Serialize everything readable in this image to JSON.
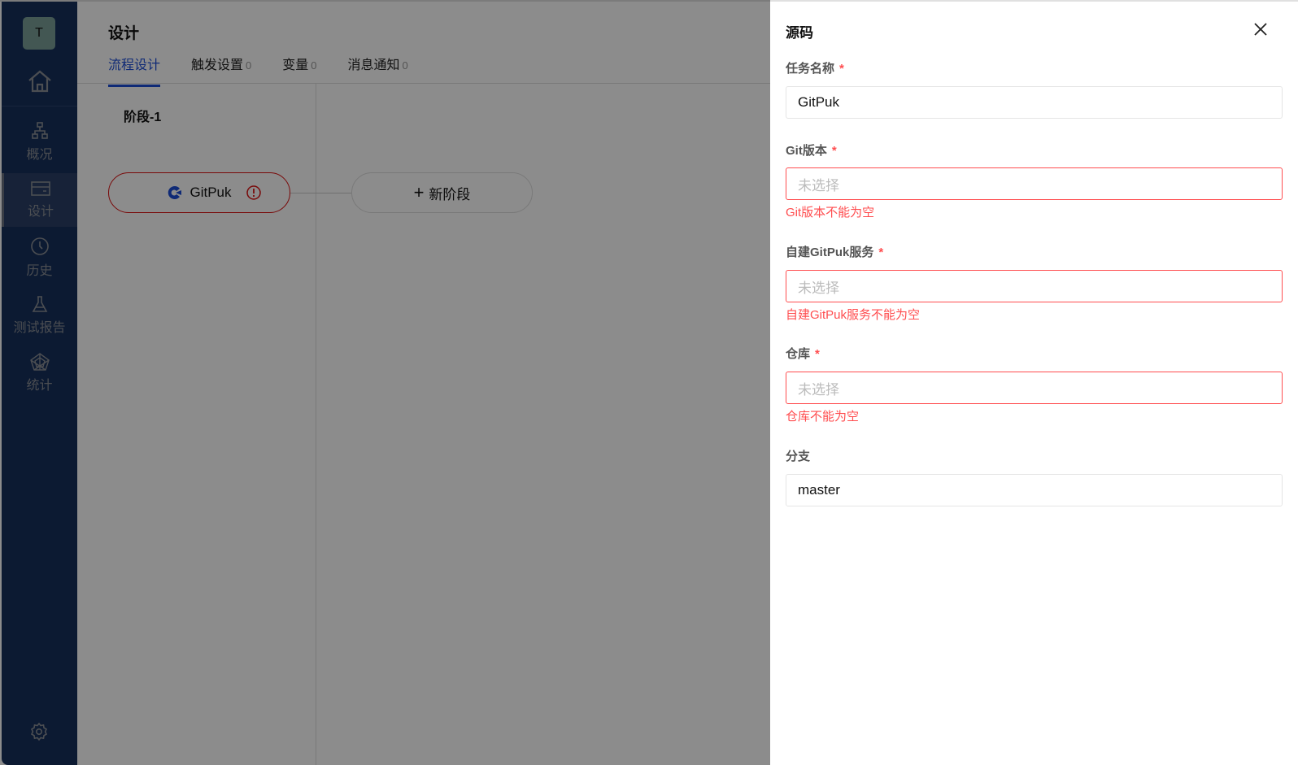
{
  "sidebar": {
    "avatar": "T",
    "items": [
      {
        "label": "概况"
      },
      {
        "label": "设计"
      },
      {
        "label": "历史"
      },
      {
        "label": "测试报告"
      },
      {
        "label": "统计"
      }
    ]
  },
  "main": {
    "title": "设计",
    "tabs": [
      {
        "label": "流程设计",
        "count": ""
      },
      {
        "label": "触发设置",
        "count": "0"
      },
      {
        "label": "变量",
        "count": "0"
      },
      {
        "label": "消息通知",
        "count": "0"
      }
    ],
    "stage": "阶段-1",
    "task_node": "GitPuk",
    "new_stage": "新阶段"
  },
  "panel": {
    "title": "源码",
    "fields": [
      {
        "label": "任务名称",
        "required": "*",
        "value": "GitPuk"
      },
      {
        "label": "Git版本",
        "required": "*",
        "placeholder": "未选择",
        "error": "Git版本不能为空"
      },
      {
        "label": "自建GitPuk服务",
        "required": "*",
        "placeholder": "未选择",
        "error": "自建GitPuk服务不能为空"
      },
      {
        "label": "仓库",
        "required": "*",
        "placeholder": "未选择",
        "error": "仓库不能为空"
      },
      {
        "label": "分支",
        "value": "master"
      }
    ]
  },
  "colors": {
    "accent": "#1d4ed8",
    "error": "#ff4d4f",
    "sidebar": "#17305c"
  }
}
